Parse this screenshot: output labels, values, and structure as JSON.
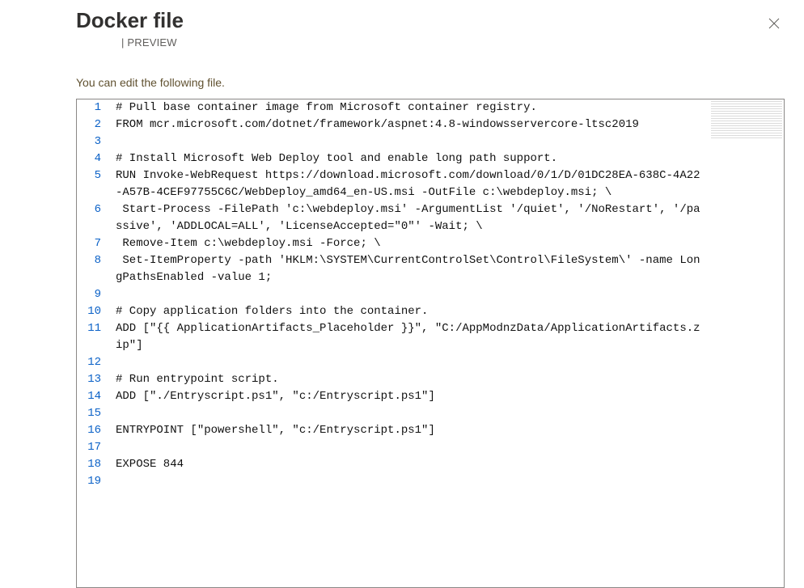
{
  "header": {
    "title": "Docker file",
    "preview_prefix": "|",
    "preview_label": "PREVIEW"
  },
  "subtext": "You can edit the following file.",
  "lines": [
    {
      "n": 1,
      "text": "# Pull base container image from Microsoft container registry."
    },
    {
      "n": 2,
      "text": "FROM mcr.microsoft.com/dotnet/framework/aspnet:4.8-windowsservercore-ltsc2019"
    },
    {
      "n": 3,
      "text": ""
    },
    {
      "n": 4,
      "text": "# Install Microsoft Web Deploy tool and enable long path support."
    },
    {
      "n": 5,
      "text": "RUN Invoke-WebRequest https://download.microsoft.com/download/0/1/D/01DC28EA-638C-4A22-A57B-4CEF97755C6C/WebDeploy_amd64_en-US.msi -OutFile c:\\webdeploy.msi; \\"
    },
    {
      "n": 6,
      "text": " Start-Process -FilePath 'c:\\webdeploy.msi' -ArgumentList '/quiet', '/NoRestart', '/passive', 'ADDLOCAL=ALL', 'LicenseAccepted=\"0\"' -Wait; \\"
    },
    {
      "n": 7,
      "text": " Remove-Item c:\\webdeploy.msi -Force; \\"
    },
    {
      "n": 8,
      "text": " Set-ItemProperty -path 'HKLM:\\SYSTEM\\CurrentControlSet\\Control\\FileSystem\\' -name LongPathsEnabled -value 1;"
    },
    {
      "n": 9,
      "text": ""
    },
    {
      "n": 10,
      "text": "# Copy application folders into the container."
    },
    {
      "n": 11,
      "text": "ADD [\"{{ ApplicationArtifacts_Placeholder }}\", \"C:/AppModnzData/ApplicationArtifacts.zip\"]"
    },
    {
      "n": 12,
      "text": ""
    },
    {
      "n": 13,
      "text": "# Run entrypoint script."
    },
    {
      "n": 14,
      "text": "ADD [\"./Entryscript.ps1\", \"c:/Entryscript.ps1\"]"
    },
    {
      "n": 15,
      "text": ""
    },
    {
      "n": 16,
      "text": "ENTRYPOINT [\"powershell\", \"c:/Entryscript.ps1\"]"
    },
    {
      "n": 17,
      "text": ""
    },
    {
      "n": 18,
      "text": "EXPOSE 844"
    },
    {
      "n": 19,
      "text": ""
    }
  ]
}
